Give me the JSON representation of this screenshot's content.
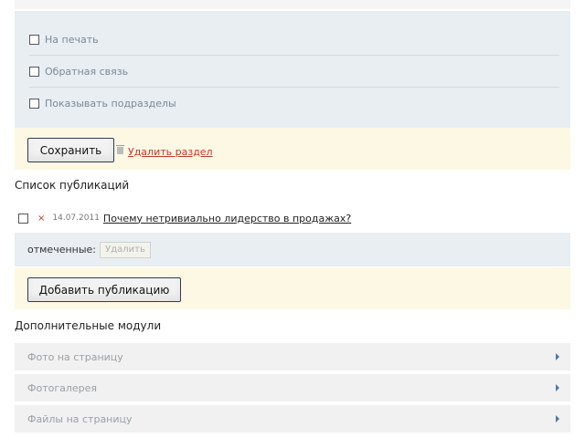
{
  "options": {
    "items": [
      {
        "label": "На печать",
        "checked": false
      },
      {
        "label": "Обратная связь",
        "checked": false
      },
      {
        "label": "Показывать подразделы",
        "checked": false
      }
    ]
  },
  "actions": {
    "save_label": "Сохранить",
    "delete_section_label": "Удалить раздел"
  },
  "publications": {
    "title": "Список публикаций",
    "items": [
      {
        "date": "14.07.2011",
        "title": "Почему нетривиально лидерство в продажах?",
        "checked": false
      }
    ],
    "marked_label": "отмеченные:",
    "delete_button_label": "Удалить",
    "add_button_label": "Добавить публикацию"
  },
  "modules": {
    "title": "Дополнительные модули",
    "items": [
      {
        "label": "Фото на страницу"
      },
      {
        "label": "Фотогалерея"
      },
      {
        "label": "Файлы на страницу"
      }
    ]
  },
  "colors": {
    "panel_blue": "#e8eef2",
    "panel_yellow": "#fdf8e4",
    "link_red": "#c0392b",
    "module_gray": "#f1f1f1",
    "arrow_blue": "#4a79a8"
  }
}
